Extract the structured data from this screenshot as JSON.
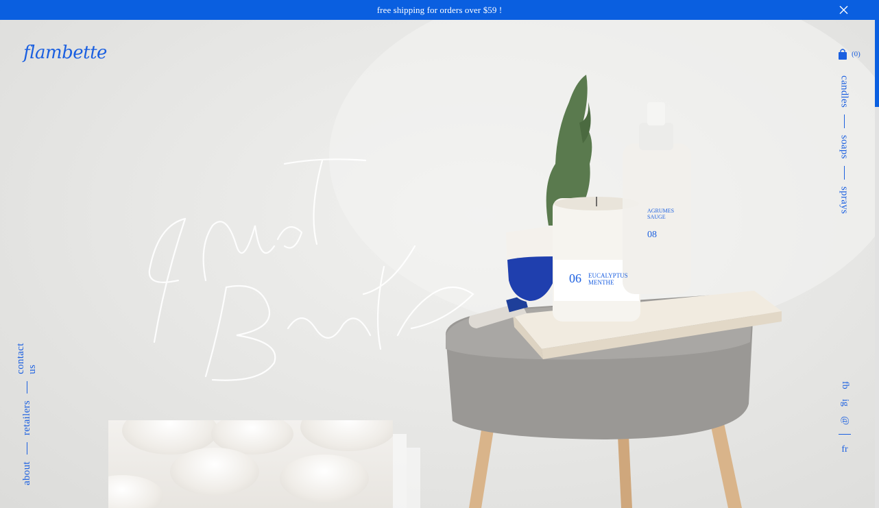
{
  "announcement": {
    "text": "free shipping for orders over $59 !"
  },
  "brand": {
    "logo": "flambette"
  },
  "cart": {
    "count": "(0)"
  },
  "nav": {
    "items": [
      "candles",
      "soaps",
      "sprays"
    ]
  },
  "left_nav": {
    "items": [
      "about",
      "retailers",
      "contact us"
    ]
  },
  "social": {
    "items": [
      "fb",
      "ig",
      "@"
    ],
    "language": "fr"
  },
  "hero": {
    "script_text": "Just Breathe",
    "candle_label": {
      "number": "06",
      "name_line1": "EUCALYPTUS",
      "name_line2": "MENTHE"
    },
    "spray_label": {
      "name_line1": "AGRUMES",
      "name_line2": "SAUGE",
      "number": "08"
    }
  },
  "colors": {
    "accent": "#0a5fe0",
    "background": "#e9e9e7"
  }
}
